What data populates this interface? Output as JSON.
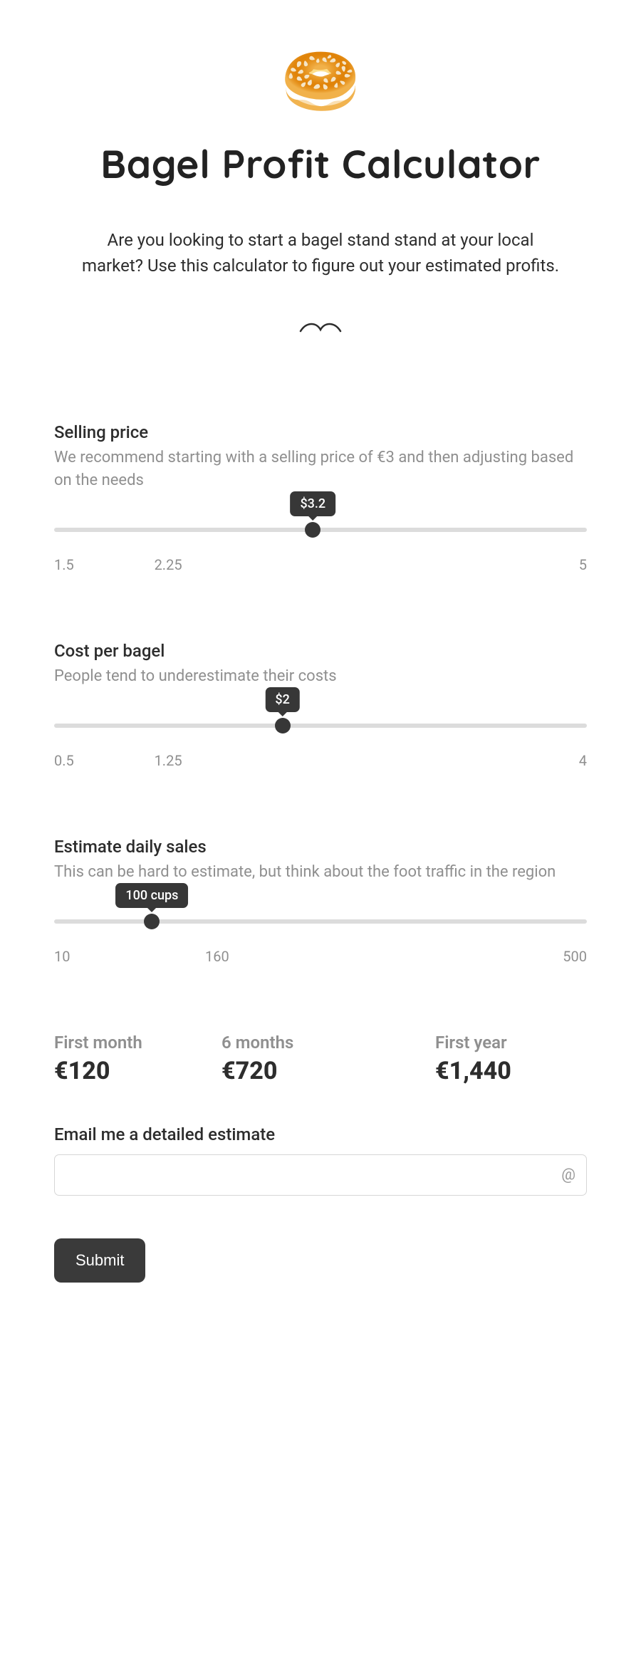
{
  "hero": {
    "title": "Bagel Profit Calculator",
    "subtitle": "Are you looking to start a bagel stand stand at your local market? Use this calculator to figure out your estimated profits."
  },
  "sliders": {
    "selling_price": {
      "label": "Selling price",
      "hint": "We recommend starting with a selling price of €3 and then adjusting based on the needs",
      "value_label": "$3.2",
      "value": 3.2,
      "min": 1.5,
      "mid": 2.25,
      "max": 5,
      "min_label": "1.5",
      "mid_label": "2.25",
      "max_label": "5",
      "thumb_pct": 48.57,
      "mid_pct": 21.4
    },
    "cost_per_bagel": {
      "label": "Cost per bagel",
      "hint": "People tend to underestimate their costs",
      "value_label": "$2",
      "value": 2,
      "min": 0.5,
      "mid": 1.25,
      "max": 4,
      "min_label": "0.5",
      "mid_label": "1.25",
      "max_label": "4",
      "thumb_pct": 42.86,
      "mid_pct": 21.4
    },
    "daily_sales": {
      "label": "Estimate daily sales",
      "hint": "This can be hard to estimate, but think about the foot traffic in the region",
      "value_label": "100 cups",
      "value": 100,
      "min": 10,
      "mid": 160,
      "max": 500,
      "min_label": "10",
      "mid_label": "160",
      "max_label": "500",
      "thumb_pct": 18.37,
      "mid_pct": 30.6
    }
  },
  "results": {
    "first_month": {
      "label": "First month",
      "value": "€120"
    },
    "six_months": {
      "label": "6 months",
      "value": "€720"
    },
    "first_year": {
      "label": "First year",
      "value": "€1,440"
    }
  },
  "email": {
    "label": "Email me a detailed estimate",
    "placeholder": ""
  },
  "submit_label": "Submit"
}
